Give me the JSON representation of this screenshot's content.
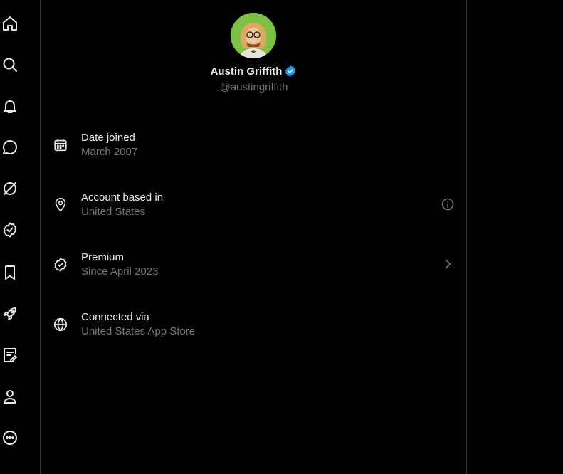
{
  "nav": {
    "items": [
      {
        "icon": "home-icon"
      },
      {
        "icon": "search-icon"
      },
      {
        "icon": "bell-icon"
      },
      {
        "icon": "message-icon"
      },
      {
        "icon": "grok-icon"
      },
      {
        "icon": "verified-icon"
      },
      {
        "icon": "bookmark-icon"
      },
      {
        "icon": "rocket-icon"
      },
      {
        "icon": "compose-icon"
      },
      {
        "icon": "profile-icon"
      },
      {
        "icon": "more-icon"
      }
    ]
  },
  "profile": {
    "name": "Austin Griffith",
    "handle": "@austingriffith",
    "verified_color": "#1d9bf0"
  },
  "about": {
    "date_joined": {
      "title": "Date joined",
      "value": "March 2007"
    },
    "account_based": {
      "title": "Account based in",
      "value": "United States"
    },
    "premium": {
      "title": "Premium",
      "value": "Since April 2023"
    },
    "connected": {
      "title": "Connected via",
      "value": "United States App Store"
    }
  }
}
